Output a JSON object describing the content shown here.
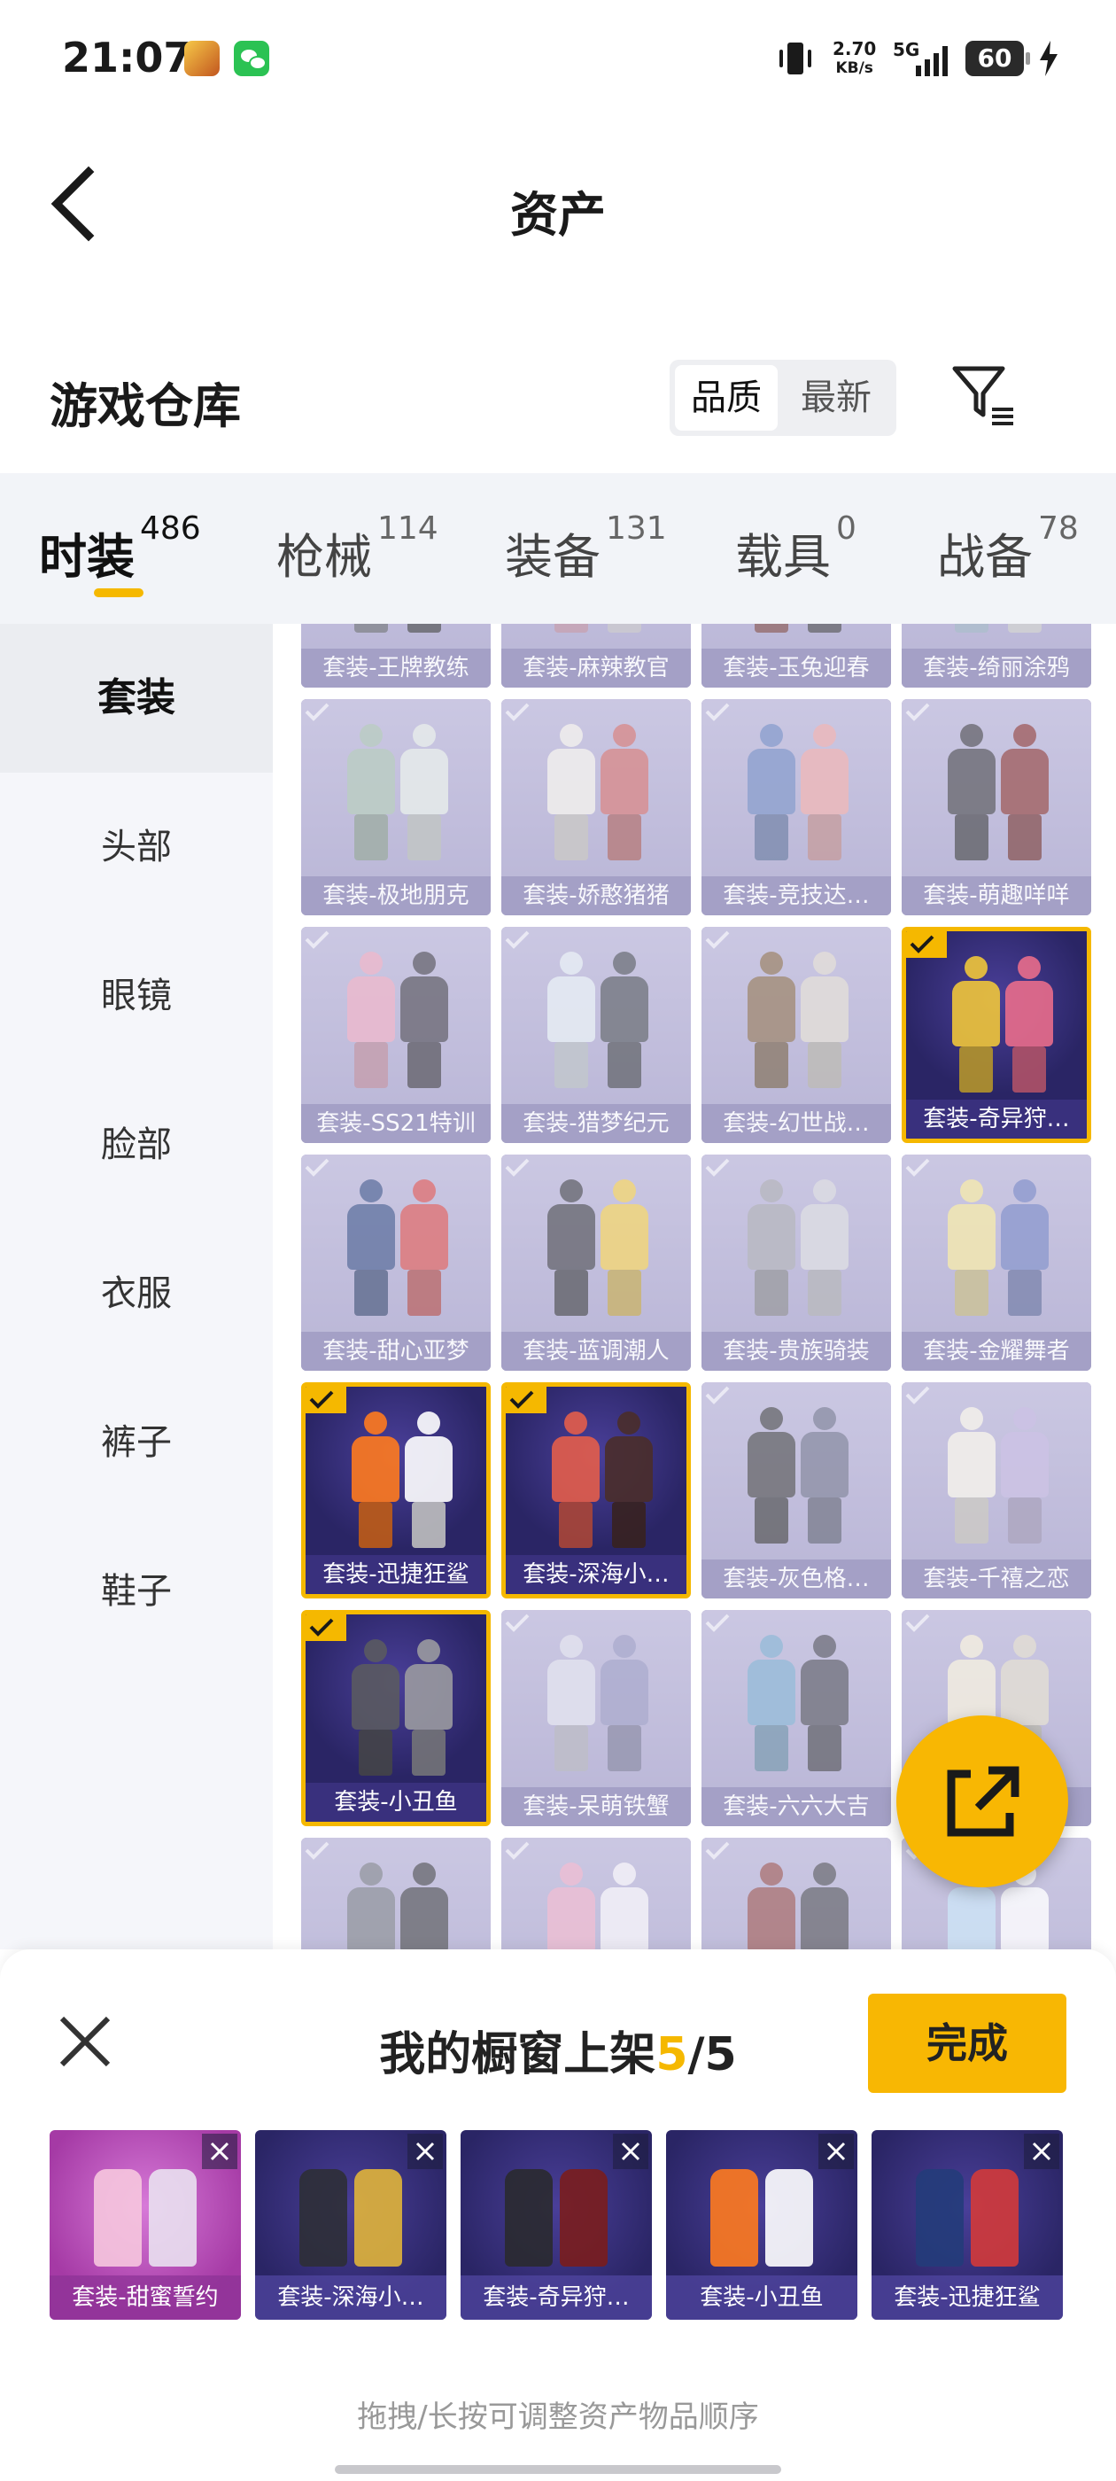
{
  "status_bar": {
    "time": "21:07",
    "speed_value": "2.70",
    "speed_unit": "KB/s",
    "network": "5G",
    "battery": "60"
  },
  "nav": {
    "title": "资产"
  },
  "warehouse": {
    "title": "游戏仓库",
    "sort_quality": "品质",
    "sort_latest": "最新"
  },
  "categories": [
    {
      "label": "时装",
      "count": "486"
    },
    {
      "label": "枪械",
      "count": "114"
    },
    {
      "label": "装备",
      "count": "131"
    },
    {
      "label": "载具",
      "count": "0"
    },
    {
      "label": "战备",
      "count": "78"
    }
  ],
  "sidebar": [
    "套装",
    "头部",
    "眼镜",
    "脸部",
    "衣服",
    "裤子",
    "鞋子"
  ],
  "items": [
    {
      "label": "套装-王牌教练",
      "selected": false
    },
    {
      "label": "套装-麻辣教官",
      "selected": false
    },
    {
      "label": "套装-玉兔迎春",
      "selected": false
    },
    {
      "label": "套装-绮丽涂鸦",
      "selected": false
    },
    {
      "label": "套装-极地朋克",
      "selected": false
    },
    {
      "label": "套装-娇憨猪猪",
      "selected": false
    },
    {
      "label": "套装-竞技达…",
      "selected": false
    },
    {
      "label": "套装-萌趣咩咩",
      "selected": false
    },
    {
      "label": "套装-SS21特训",
      "selected": false
    },
    {
      "label": "套装-猎梦纪元",
      "selected": false
    },
    {
      "label": "套装-幻世战…",
      "selected": false
    },
    {
      "label": "套装-奇异狩…",
      "selected": true
    },
    {
      "label": "套装-甜心亚梦",
      "selected": false
    },
    {
      "label": "套装-蓝调潮人",
      "selected": false
    },
    {
      "label": "套装-贵族骑装",
      "selected": false
    },
    {
      "label": "套装-金耀舞者",
      "selected": false
    },
    {
      "label": "套装-迅捷狂鲨",
      "selected": true
    },
    {
      "label": "套装-深海小…",
      "selected": true
    },
    {
      "label": "套装-灰色格…",
      "selected": false
    },
    {
      "label": "套装-千禧之恋",
      "selected": false
    },
    {
      "label": "套装-小丑鱼",
      "selected": true
    },
    {
      "label": "套装-呆萌铁蟹",
      "selected": false
    },
    {
      "label": "套装-六六大吉",
      "selected": false
    },
    {
      "label": "士",
      "selected": false
    },
    {
      "label": "",
      "selected": false
    },
    {
      "label": "",
      "selected": false
    },
    {
      "label": "",
      "selected": false
    },
    {
      "label": "",
      "selected": false
    }
  ],
  "showcase": {
    "title_prefix": "我的橱窗上架",
    "count": "5",
    "total": "/5",
    "done": "完成",
    "items": [
      "套装-甜蜜誓约",
      "套装-深海小…",
      "套装-奇异狩…",
      "套装-小丑鱼",
      "套装-迅捷狂鲨"
    ],
    "hint": "拖拽/长按可调整资产物品顺序"
  },
  "colors": {
    "accent": "#f5b800",
    "tile": "#9d97c2",
    "selected_bg": "#2a2760"
  }
}
